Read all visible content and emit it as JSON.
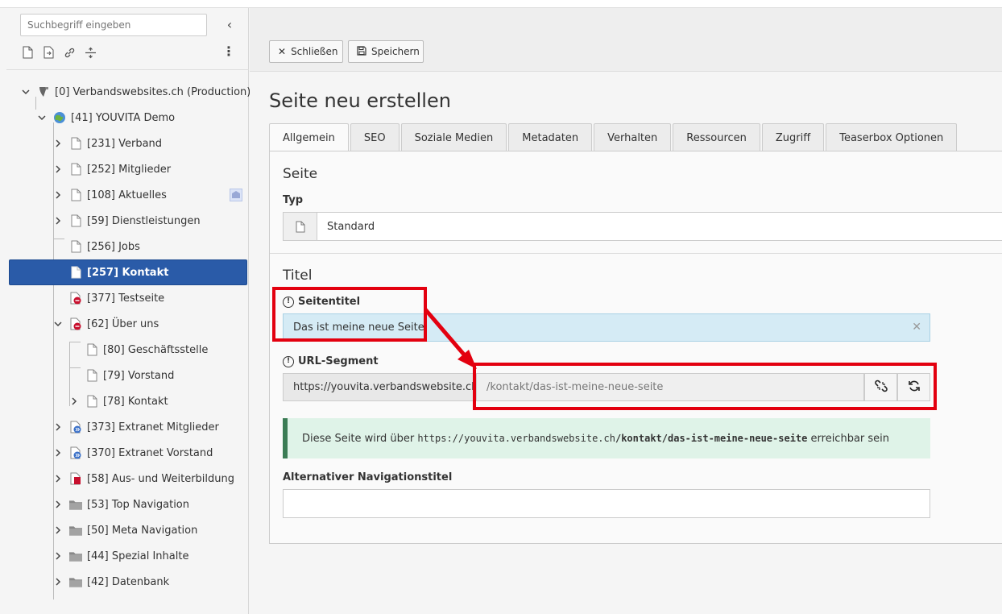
{
  "sidebar": {
    "search_placeholder": "Suchbegriff eingeben",
    "tools": [
      "new-page-icon",
      "page-copy-icon",
      "link-icon",
      "divider-icon"
    ],
    "tree": [
      {
        "label": "[0] Verbandswebsites.ch (Production)",
        "icon": "typo3-logo-icon",
        "open": true
      },
      {
        "label": "[41] YOUVITA Demo",
        "icon": "globe-icon",
        "open": true
      },
      {
        "label": "[231] Verband",
        "icon": "page-icon"
      },
      {
        "label": "[252] Mitglieder",
        "icon": "page-icon"
      },
      {
        "label": "[108] Aktuelles",
        "icon": "page-icon"
      },
      {
        "label": "[59] Dienstleistungen",
        "icon": "page-icon"
      },
      {
        "label": "[256] Jobs",
        "icon": "page-icon"
      },
      {
        "label": "[257] Kontakt",
        "icon": "page-icon",
        "selected": true
      },
      {
        "label": "[377] Testseite",
        "icon": "page-hidden-icon"
      },
      {
        "label": "[62] Über uns",
        "icon": "page-hidden-icon",
        "open": true
      },
      {
        "label": "[80] Geschäftsstelle",
        "icon": "page-icon"
      },
      {
        "label": "[79] Vorstand",
        "icon": "page-icon"
      },
      {
        "label": "[78] Kontakt",
        "icon": "page-icon"
      },
      {
        "label": "[373] Extranet Mitglieder",
        "icon": "page-shortcut-icon"
      },
      {
        "label": "[370] Extranet Vorstand",
        "icon": "page-shortcut-icon"
      },
      {
        "label": "[58] Aus- und Weiterbildung",
        "icon": "page-hidden-icon"
      },
      {
        "label": "[53] Top Navigation",
        "icon": "folder-icon"
      },
      {
        "label": "[50] Meta Navigation",
        "icon": "folder-icon"
      },
      {
        "label": "[44] Spezial Inhalte",
        "icon": "folder-icon"
      },
      {
        "label": "[42] Datenbank",
        "icon": "folder-icon"
      }
    ]
  },
  "toolbar": {
    "close_label": "Schließen",
    "save_label": "Speichern"
  },
  "page": {
    "title": "Seite neu erstellen",
    "tabs": [
      "Allgemein",
      "SEO",
      "Soziale Medien",
      "Metadaten",
      "Verhalten",
      "Ressourcen",
      "Zugriff",
      "Teaserbox Optionen"
    ],
    "section_page": "Seite",
    "type_label": "Typ",
    "type_value": "Standard",
    "section_title": "Titel",
    "seitentitel_label": "Seitentitel",
    "seitentitel_value": "Das ist meine neue Seite",
    "url_label": "URL-Segment",
    "url_prefix": "https://youvita.verbandswebsite.ch",
    "url_value": "/kontakt/das-ist-meine-neue-seite",
    "notice_pre": "Diese Seite wird über ",
    "notice_url_base": "https://youvita.verbandswebsite.ch",
    "notice_url_path": "/kontakt/das-ist-meine-neue-seite",
    "notice_post": " erreichbar sein",
    "alt_nav_label": "Alternativer Navigationstitel"
  },
  "colors": {
    "selected": "#2a5ba8",
    "highlight": "#e3000f",
    "notice": "#3b7c55"
  }
}
